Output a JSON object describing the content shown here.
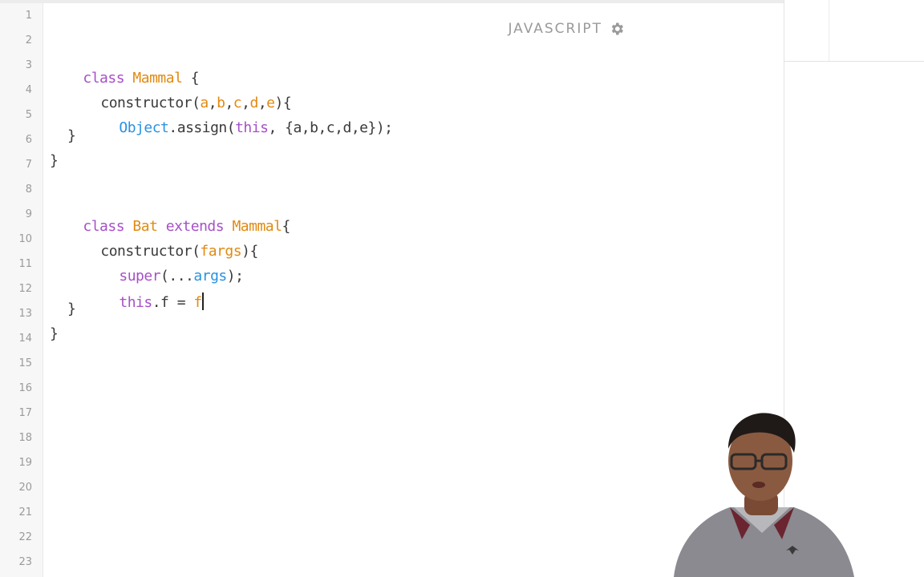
{
  "editor": {
    "language_label": "JAVASCRIPT",
    "settings_icon": "gear-icon",
    "line_numbers": [
      "1",
      "2",
      "3",
      "4",
      "5",
      "6",
      "7",
      "8",
      "9",
      "10",
      "11",
      "12",
      "13",
      "14",
      "15",
      "16",
      "17",
      "18",
      "19",
      "20",
      "21",
      "22",
      "23"
    ]
  },
  "code": {
    "l3": {
      "kw": "class",
      "name": "Mammal",
      "rest": " {"
    },
    "l4": {
      "fn": "constructor(",
      "p1": "a",
      ",1": ",",
      "p2": "b",
      ",2": ",",
      "p3": "c",
      ",3": ",",
      "p4": "d",
      ",4": ",",
      "p5": "e",
      "end": "){"
    },
    "l5": {
      "obj": "Object",
      "assign": ".assign(",
      "this": "this",
      ", ": ", {a,b,c,d,e});"
    },
    "l6": {
      "text": "}"
    },
    "l7": {
      "text": "}"
    },
    "l9": {
      "kw": "class",
      "name": "Bat",
      "ext": "extends",
      "parent": "Mammal",
      "rest": "{"
    },
    "l10": {
      "fn": "constructor(",
      "p1": "f",
      ", ...": ", ...",
      "p2": "args",
      "end": "){"
    },
    "l11": {
      "kw": "super",
      "mid": "(...",
      "arg": "args",
      "end": ");"
    },
    "l12": {
      "kw": "this",
      "mid": ".f = ",
      "val": "f"
    },
    "l13": {
      "text": "}"
    },
    "l14": {
      "text": "}"
    }
  },
  "colors": {
    "keyword": "#a650c8",
    "class_name": "#e18a12",
    "builtin": "#2b91e0",
    "text": "#3a3a3a",
    "line_number": "#9a9a9a"
  }
}
